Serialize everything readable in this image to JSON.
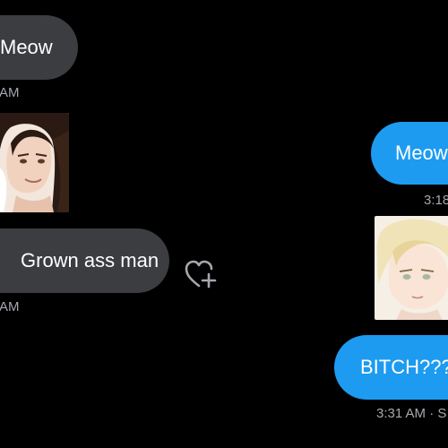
{
  "colors": {
    "background": "#000000",
    "received_bubble": "#3b3d40",
    "sent_bubble": "#1d9bf0",
    "timestamp": "#a4a8ad"
  },
  "messages": {
    "received_1": {
      "text": "Meow",
      "time": "AM"
    },
    "received_image": {
      "alt_icon": "long-hair-anime-character-image"
    },
    "received_2": {
      "text": "Grown ass man",
      "time": "AM"
    },
    "sent_1": {
      "text": "Meow",
      "time": "3:18"
    },
    "sent_image": {
      "alt_icon": "blonde-anime-character-image"
    },
    "sent_2": {
      "text": "BITCH???",
      "time": "3:31 AM · S"
    }
  },
  "icons": {
    "react": "heart-plus-icon"
  }
}
